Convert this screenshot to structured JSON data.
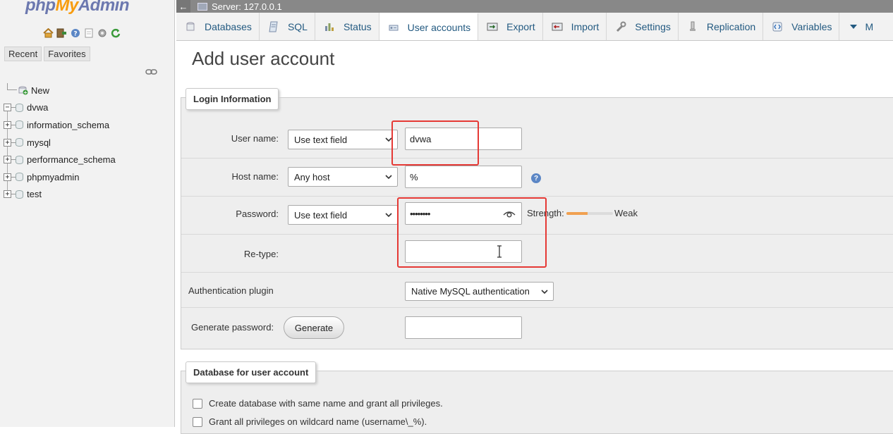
{
  "sidebar": {
    "logo": {
      "php": "php",
      "my": "My",
      "admin": "Admin"
    },
    "quick_icons": [
      "home-icon",
      "logout-icon",
      "help-icon",
      "docs-icon",
      "settings-icon",
      "reload-icon"
    ],
    "tabs": [
      "Recent",
      "Favorites"
    ],
    "tree": [
      {
        "label": "New",
        "kind": "new"
      },
      {
        "label": "dvwa",
        "kind": "db",
        "expander": "−"
      },
      {
        "label": "information_schema",
        "kind": "db",
        "expander": "+"
      },
      {
        "label": "mysql",
        "kind": "db",
        "expander": "+"
      },
      {
        "label": "performance_schema",
        "kind": "db",
        "expander": "+"
      },
      {
        "label": "phpmyadmin",
        "kind": "db",
        "expander": "+"
      },
      {
        "label": "test",
        "kind": "db",
        "expander": "+"
      }
    ]
  },
  "topbar": {
    "back": "←",
    "server": "Server: 127.0.0.1"
  },
  "tabs": [
    {
      "label": "Databases",
      "icon": "database-icon",
      "active": false
    },
    {
      "label": "SQL",
      "icon": "sql-icon",
      "active": false
    },
    {
      "label": "Status",
      "icon": "status-icon",
      "active": false
    },
    {
      "label": "User accounts",
      "icon": "users-icon",
      "active": true
    },
    {
      "label": "Export",
      "icon": "export-icon",
      "active": false
    },
    {
      "label": "Import",
      "icon": "import-icon",
      "active": false
    },
    {
      "label": "Settings",
      "icon": "wrench-icon",
      "active": false
    },
    {
      "label": "Replication",
      "icon": "replication-icon",
      "active": false
    },
    {
      "label": "Variables",
      "icon": "variables-icon",
      "active": false
    },
    {
      "label": "M",
      "icon": "more-chevron-icon",
      "active": false
    }
  ],
  "main": {
    "title": "Add user account",
    "login": {
      "legend": "Login Information",
      "user_name": {
        "label": "User name:",
        "select": "Use text field",
        "value": "dvwa"
      },
      "host_name": {
        "label": "Host name:",
        "select": "Any host",
        "value": "%"
      },
      "password": {
        "label": "Password:",
        "select": "Use text field",
        "value": "••••••••",
        "strength_label": "Strength:",
        "strength_text": "Weak",
        "strength_percent": 45
      },
      "retype": {
        "label": "Re-type:",
        "value": ""
      },
      "auth_plugin": {
        "label": "Authentication plugin",
        "select": "Native MySQL authentication"
      },
      "generate": {
        "label": "Generate password:",
        "button": "Generate",
        "value": ""
      }
    },
    "database": {
      "legend": "Database for user account",
      "options": [
        "Create database with same name and grant all privileges.",
        "Grant all privileges on wildcard name (username\\_%)."
      ]
    }
  },
  "colors": {
    "accent": "#235a81",
    "highlight": "#e53935",
    "strength_fill": "#f0a050"
  }
}
